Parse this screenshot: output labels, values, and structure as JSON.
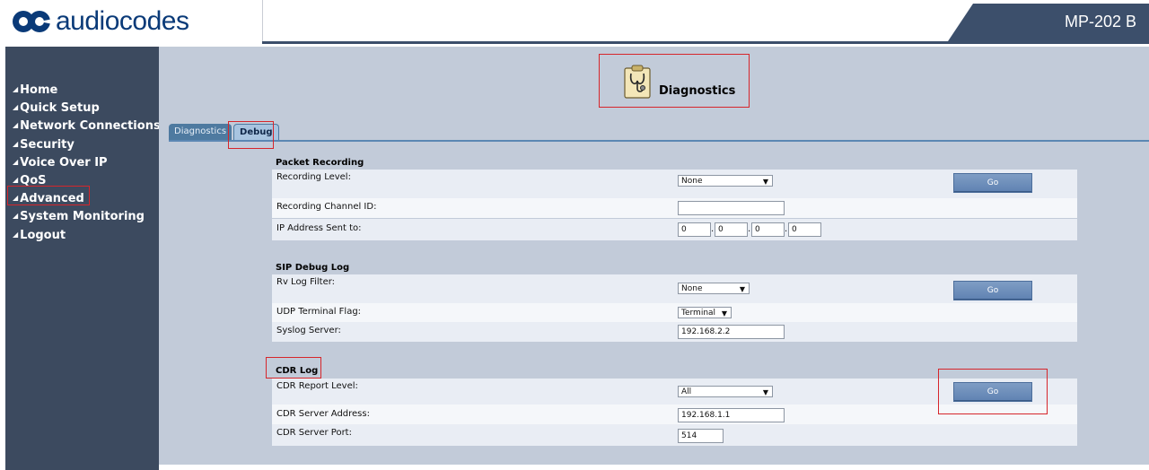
{
  "header": {
    "brand": "audiocodes",
    "model": "MP-202 B"
  },
  "sidebar": {
    "items": [
      {
        "label": "Home"
      },
      {
        "label": "Quick Setup"
      },
      {
        "label": "Network Connections"
      },
      {
        "label": "Security"
      },
      {
        "label": "Voice Over IP"
      },
      {
        "label": "QoS"
      },
      {
        "label": "Advanced"
      },
      {
        "label": "System Monitoring"
      },
      {
        "label": "Logout"
      }
    ]
  },
  "page": {
    "title": "Diagnostics"
  },
  "tabs": [
    {
      "label": "Diagnostics"
    },
    {
      "label": "Debug"
    }
  ],
  "packet_recording": {
    "title": "Packet Recording",
    "recording_level_label": "Recording Level:",
    "recording_level_value": "None",
    "channel_id_label": "Recording Channel ID:",
    "channel_id_value": "",
    "ip_label": "IP Address Sent to:",
    "ip_octets": [
      "0",
      "0",
      "0",
      "0"
    ],
    "go_label": "Go"
  },
  "sip_debug": {
    "title": "SIP Debug Log",
    "rv_filter_label": "Rv Log Filter:",
    "rv_filter_value": "None",
    "udp_flag_label": "UDP Terminal Flag:",
    "udp_flag_value": "Terminal",
    "syslog_label": "Syslog Server:",
    "syslog_value": "192.168.2.2",
    "go_label": "Go"
  },
  "cdr_log": {
    "title": "CDR Log",
    "report_level_label": "CDR Report Level:",
    "report_level_value": "All",
    "server_address_label": "CDR Server Address:",
    "server_address_value": "192.168.1.1",
    "server_port_label": "CDR Server Port:",
    "server_port_value": "514",
    "go_label": "Go"
  },
  "icons": {
    "diagnostics": "clipboard-stethoscope-icon",
    "select_arrow": "triangle-down-icon"
  },
  "colors": {
    "header_dark": "#3c4f6b",
    "sidebar": "#3c4a5f",
    "content_bg": "#c2cbd9",
    "highlight": "#d6262b",
    "brand": "#0a3a78"
  }
}
